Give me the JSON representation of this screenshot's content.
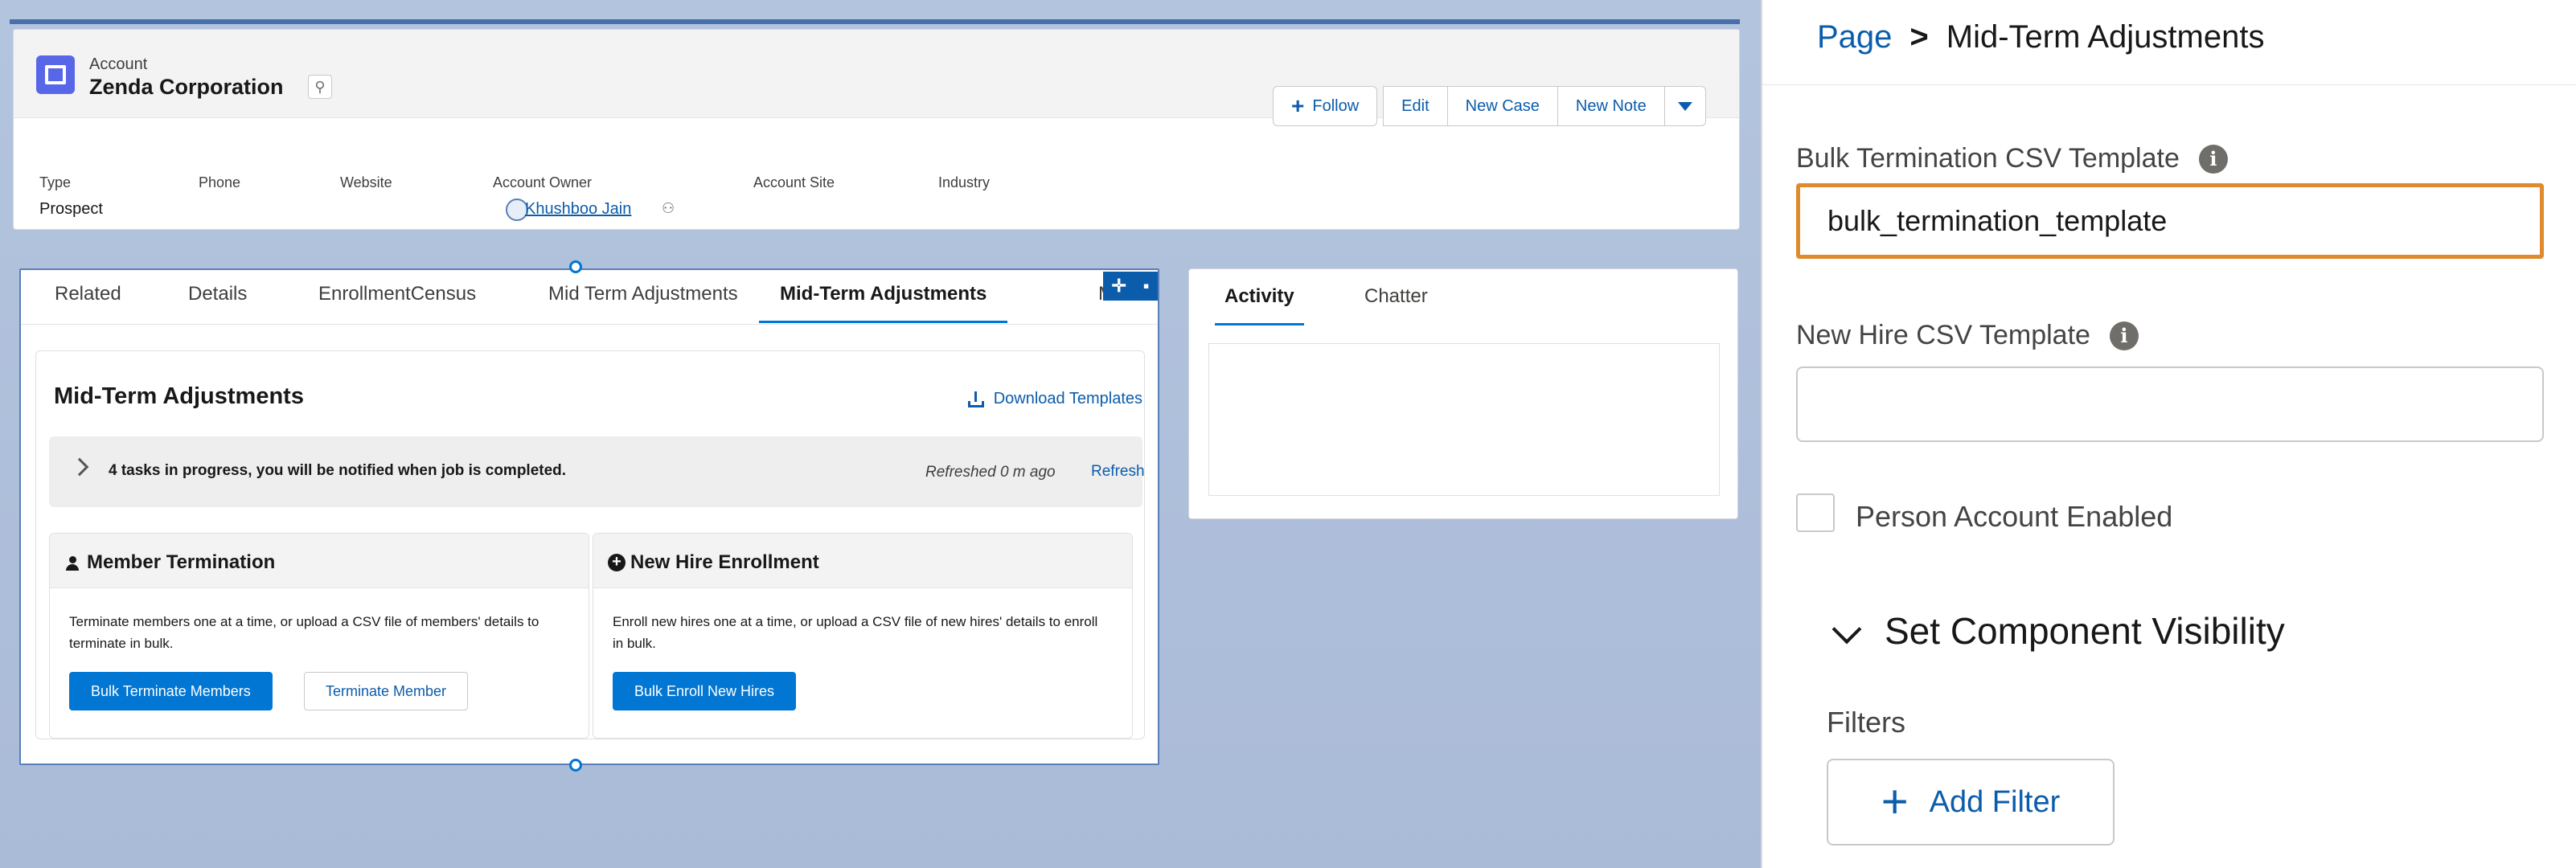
{
  "record": {
    "object_label": "Account",
    "name": "Zenda Corporation",
    "actions": {
      "follow": "Follow",
      "edit": "Edit",
      "new_case": "New Case",
      "new_note": "New Note"
    },
    "fields": {
      "type_label": "Type",
      "type_value": "Prospect",
      "phone_label": "Phone",
      "website_label": "Website",
      "owner_label": "Account Owner",
      "owner_value": "Khushboo Jain",
      "site_label": "Account Site",
      "industry_label": "Industry"
    }
  },
  "tabs": [
    "Related",
    "Details",
    "EnrollmentCensus",
    "Mid Term Adjustments",
    "Mid-Term Adjustments",
    "More"
  ],
  "active_tab": "Mid-Term Adjustments",
  "mta": {
    "title": "Mid-Term Adjustments",
    "download_link": "Download Templates",
    "progress_text": "4 tasks in progress, you will be notified when job is completed.",
    "refreshed_text": "Refreshed 0 m ago",
    "refresh_link": "Refresh",
    "member_termination": {
      "title": "Member Termination",
      "description": "Terminate members one at a time, or upload a CSV file of members' details to terminate in bulk.",
      "bulk_button": "Bulk Terminate Members",
      "single_button": "Terminate Member"
    },
    "new_hire": {
      "title": "New Hire Enrollment",
      "description": "Enroll new hires one at a time, or upload a CSV file of new hires' details to enroll in bulk.",
      "bulk_button": "Bulk Enroll New Hires"
    }
  },
  "side_tabs": [
    "Activity",
    "Chatter"
  ],
  "properties": {
    "breadcrumb_page": "Page",
    "breadcrumb_sep": ">",
    "breadcrumb_current": "Mid-Term Adjustments",
    "bulk_termination_label": "Bulk Termination CSV Template",
    "bulk_termination_value": "bulk_termination_template",
    "new_hire_label": "New Hire CSV Template",
    "new_hire_value": "",
    "person_account_label": "Person Account Enabled",
    "person_account_checked": false,
    "visibility_title": "Set Component Visibility",
    "filters_label": "Filters",
    "add_filter": "Add Filter"
  },
  "colors": {
    "brand": "#0176d3",
    "link": "#0b5cab",
    "focus_outline": "#e08a2e",
    "canvas_bg": "#b0c1dc",
    "account_icon": "#5867e8"
  }
}
